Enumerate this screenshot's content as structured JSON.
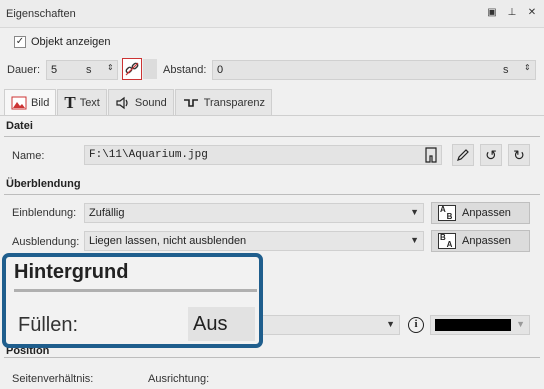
{
  "window": {
    "title": "Eigenschaften"
  },
  "show_object": {
    "label": "Objekt anzeigen",
    "checked": true
  },
  "timing": {
    "duration_label": "Dauer:",
    "duration_value": "5",
    "duration_unit": "s",
    "spacing_label": "Abstand:",
    "spacing_value": "0",
    "spacing_unit": "s"
  },
  "tabs": [
    {
      "label": "Bild",
      "icon": "image-icon",
      "active": true
    },
    {
      "label": "Text",
      "icon": "text-icon"
    },
    {
      "label": "Sound",
      "icon": "speaker-icon"
    },
    {
      "label": "Transparenz",
      "icon": "transparency-icon"
    }
  ],
  "file_section": {
    "title": "Datei",
    "name_label": "Name:",
    "name_value": "F:\\11\\Aquarium.jpg"
  },
  "transition_section": {
    "title": "Überblendung",
    "fade_in_label": "Einblendung:",
    "fade_in_value": "Zufällig",
    "fade_in_button": "Anpassen",
    "fade_in_icon_top": "A",
    "fade_in_icon_bottom": "B",
    "fade_out_label": "Ausblendung:",
    "fade_out_value": "Liegen lassen, nicht ausblenden",
    "fade_out_button": "Anpassen",
    "fade_out_icon_top": "B",
    "fade_out_icon_bottom": "A"
  },
  "background_callout": {
    "title": "Hintergrund",
    "fill_label": "Füllen:",
    "fill_value": "Aus"
  },
  "fill_color": "#000000",
  "position_section": {
    "title": "Position",
    "aspect_label": "Seitenverhältnis:",
    "alignment_label": "Ausrichtung:"
  }
}
